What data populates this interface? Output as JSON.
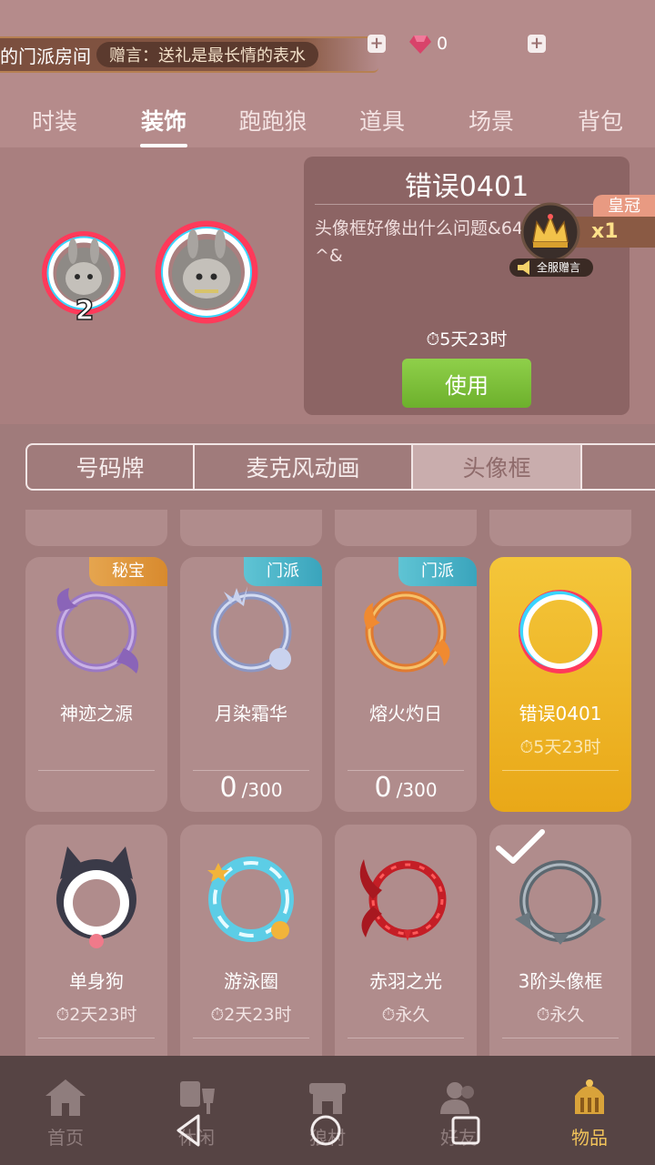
{
  "topbar": {
    "room_text": "的门派房间",
    "gift_text": "赠言：送礼是最长情的表水",
    "gem_count": "0",
    "plus_label": "+"
  },
  "tabs": [
    {
      "label": "时装",
      "active": false
    },
    {
      "label": "装饰",
      "active": true
    },
    {
      "label": "跑跑狼",
      "active": false
    },
    {
      "label": "道具",
      "active": false
    },
    {
      "label": "场景",
      "active": false
    },
    {
      "label": "背包",
      "active": false
    }
  ],
  "preview": {
    "small_avatar_number": "2",
    "title": "错误0401",
    "description": "头像框好像出什么问题&64^&",
    "timer": "⏱5天23时",
    "use_button": "使用",
    "crown_label": "皇冠",
    "crown_count": "x1",
    "broadcast_label": "全服赠言"
  },
  "segments": [
    {
      "label": "号码牌",
      "active": false
    },
    {
      "label": "麦克风动画",
      "active": false
    },
    {
      "label": "头像框",
      "active": true
    }
  ],
  "items": [
    {
      "name": "神迹之源",
      "tag": "秘宝",
      "tag_type": "secret",
      "timer": "",
      "progress_current": "",
      "progress_total": "",
      "color": "#9a78c4"
    },
    {
      "name": "月染霜华",
      "tag": "门派",
      "tag_type": "sect",
      "timer": "",
      "progress_current": "0",
      "progress_total": "/300",
      "color": "#a6b4d8"
    },
    {
      "name": "熔火灼日",
      "tag": "门派",
      "tag_type": "sect",
      "timer": "",
      "progress_current": "0",
      "progress_total": "/300",
      "color": "#e8843a"
    },
    {
      "name": "错误0401",
      "tag": "",
      "tag_type": "",
      "timer": "⏱5天23时",
      "progress_current": "",
      "progress_total": "",
      "color": "#ffffff",
      "selected": true
    },
    {
      "name": "单身狗",
      "tag": "",
      "tag_type": "",
      "timer": "⏱2天23时",
      "progress_current": "",
      "progress_total": "",
      "color": "#ffffff"
    },
    {
      "name": "游泳圈",
      "tag": "",
      "tag_type": "",
      "timer": "⏱2天23时",
      "progress_current": "",
      "progress_total": "",
      "color": "#5ccde6"
    },
    {
      "name": "赤羽之光",
      "tag": "",
      "tag_type": "",
      "timer": "⏱永久",
      "progress_current": "",
      "progress_total": "",
      "color": "#d8282e"
    },
    {
      "name": "3阶头像框",
      "tag": "",
      "tag_type": "",
      "timer": "⏱永久",
      "progress_current": "",
      "progress_total": "",
      "color": "#7e8a94",
      "equipped": true
    }
  ],
  "bottom_nav": [
    {
      "label": "首页",
      "icon": "home-icon",
      "active": false
    },
    {
      "label": "休闲",
      "icon": "leisure-icon",
      "active": false
    },
    {
      "label": "狼村",
      "icon": "village-icon",
      "active": false
    },
    {
      "label": "好友",
      "icon": "friends-icon",
      "active": false
    },
    {
      "label": "物品",
      "icon": "items-icon",
      "active": true
    }
  ],
  "colors": {
    "accent_gold": "#f1c35a",
    "use_green": "#7cc23a",
    "tag_secret": "#e09a3f",
    "tag_sect": "#4bb4c8"
  }
}
